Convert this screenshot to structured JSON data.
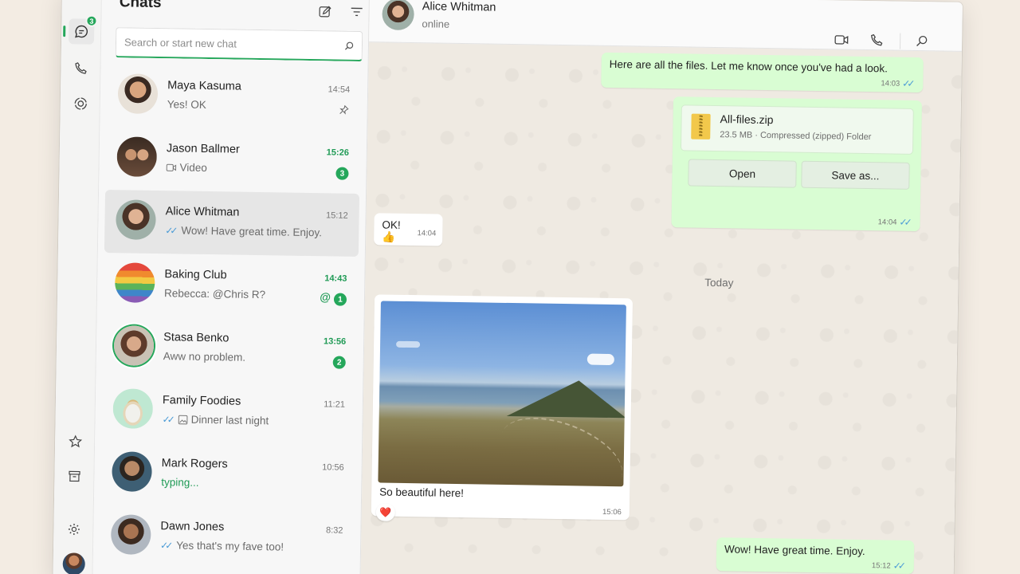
{
  "rail": {
    "chats_badge": "3"
  },
  "list": {
    "title": "Chats",
    "search_placeholder": "Search or start new chat",
    "chats": [
      {
        "name": "Maya Kasuma",
        "preview": "Yes! OK",
        "time": "14:54",
        "pinned": true
      },
      {
        "name": "Jason Ballmer",
        "preview": "Video",
        "time": "15:26",
        "unread": "3"
      },
      {
        "name": "Alice Whitman",
        "preview": "Wow! Have great time. Enjoy.",
        "time": "15:12"
      },
      {
        "name": "Baking Club",
        "preview": "Rebecca: @Chris R?",
        "time": "14:43",
        "unread": "1",
        "mention": "@"
      },
      {
        "name": "Stasa Benko",
        "preview": "Aww no problem.",
        "time": "13:56",
        "unread": "2"
      },
      {
        "name": "Family Foodies",
        "preview": "Dinner last night",
        "time": "11:21"
      },
      {
        "name": "Mark Rogers",
        "preview": "typing...",
        "time": "10:56"
      },
      {
        "name": "Dawn Jones",
        "preview": "Yes that's my fave too!",
        "time": "8:32"
      }
    ]
  },
  "header": {
    "name": "Alice Whitman",
    "status": "online"
  },
  "messages": {
    "m1_text": "Here are all the files. Let me know once you've had a look.",
    "m1_time": "14:03",
    "file_name": "All-files.zip",
    "file_meta": "23.5 MB · Compressed (zipped) Folder",
    "open_label": "Open",
    "save_label": "Save as...",
    "m2_time": "14:04",
    "ok_text": "OK! 👍",
    "ok_time": "14:04",
    "date_label": "Today",
    "photo_caption": "So beautiful here!",
    "photo_time": "15:06",
    "photo_reaction": "❤️",
    "last_text": "Wow! Have great time. Enjoy.",
    "last_time": "15:12"
  },
  "colors": {
    "accent": "#25a75b",
    "outgoing_bubble": "#d9fdd3",
    "chat_bg": "#efeae2"
  }
}
